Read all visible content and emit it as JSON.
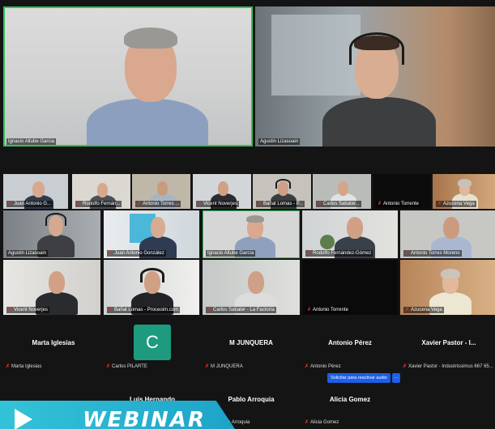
{
  "main_tiles": [
    {
      "name": "Ignacio Altube Garcia"
    },
    {
      "name": "Agustin Lizasoain"
    }
  ],
  "grid_row1": [
    {
      "name": "Juan Antonio G..."
    },
    {
      "name": "Rodolfo Fernán..."
    },
    {
      "name": "Antonio Torres ..."
    },
    {
      "name": "Vicent Noverjes"
    },
    {
      "name": "Bañat Lomas - P..."
    },
    {
      "name": "Carlos Sabater..."
    },
    {
      "name": "Antonio Torrente"
    },
    {
      "name": "Azucena Vega"
    }
  ],
  "grid_row2": [
    {
      "name": "Agustin Lizasoain"
    },
    {
      "name": "Juan Antonio González"
    },
    {
      "name": "Ignacio Altube García"
    },
    {
      "name": "Rodolfo Fernández-Gómez"
    },
    {
      "name": "Antonio Torres Moreno"
    }
  ],
  "grid_row3": [
    {
      "name": "Vicent Noverjes"
    },
    {
      "name": "Bañat Lomas - Proceoim.com"
    },
    {
      "name": "Carlos Sabater - La Factoría"
    },
    {
      "name": "Antonio Torrente"
    },
    {
      "name": "Azucena Vega"
    }
  ],
  "participants_row1": [
    {
      "display": "Marta Iglesias",
      "label": "Marta Iglesias"
    },
    {
      "display": "C",
      "label": "Carlos PILARTE"
    },
    {
      "display": "M JUNQUERA",
      "label": "M JUNQUERA"
    },
    {
      "display": "Antonio Pérez",
      "label": "Antonio Pérez"
    },
    {
      "display": "Xavier Pastor - I...",
      "label": "Xavier Pastor - Industrissimus 667 65..."
    }
  ],
  "participants_row2": [
    {
      "display": "Luis Hernando"
    },
    {
      "display": "Pablo Arroquia",
      "label": "Pablo Arroquia"
    },
    {
      "display": "Alicia Gomez",
      "label": "Alicia Gomez"
    }
  ],
  "unmute_request": "Solicitar para reactivar audio",
  "more_button": "···",
  "banner": {
    "text": "WEBINAR"
  },
  "colors": {
    "speaker_border": "#33c15a",
    "muted_icon": "#e0302b",
    "accent_blue": "#1d5fe6",
    "banner": "#33c3d8"
  }
}
